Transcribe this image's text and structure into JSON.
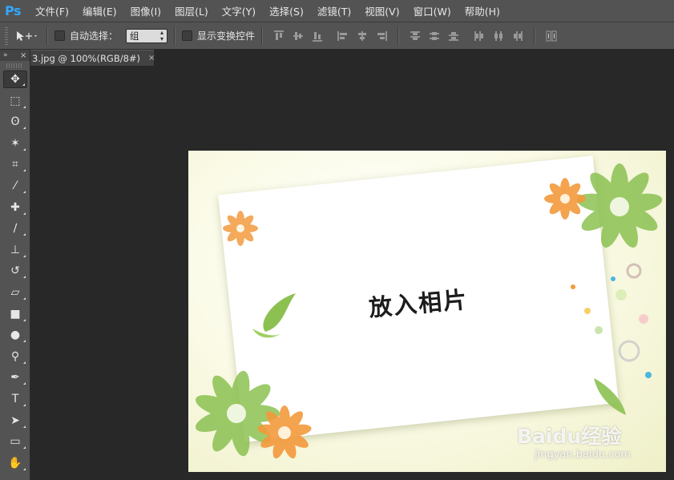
{
  "app": {
    "logo": "Ps"
  },
  "menu": [
    "文件(F)",
    "编辑(E)",
    "图像(I)",
    "图层(L)",
    "文字(Y)",
    "选择(S)",
    "滤镜(T)",
    "视图(V)",
    "窗口(W)",
    "帮助(H)"
  ],
  "options": {
    "auto_select_label": "自动选择：",
    "auto_select_value": "组",
    "show_transform_label": "显示变换控件"
  },
  "panel": {
    "collapse_glyph": "»",
    "close_glyph": "×"
  },
  "document_tab": {
    "title": "3.jpg @ 100%(RGB/8#)",
    "close_glyph": "×"
  },
  "tools": [
    {
      "name": "move-tool-icon",
      "glyph": "✥"
    },
    {
      "name": "marquee-tool-icon",
      "glyph": "⬚"
    },
    {
      "name": "lasso-tool-icon",
      "glyph": "ʘ"
    },
    {
      "name": "magic-wand-tool-icon",
      "glyph": "✶"
    },
    {
      "name": "crop-tool-icon",
      "glyph": "⌗"
    },
    {
      "name": "eyedropper-tool-icon",
      "glyph": "⁄"
    },
    {
      "name": "healing-brush-tool-icon",
      "glyph": "✚"
    },
    {
      "name": "brush-tool-icon",
      "glyph": "∕"
    },
    {
      "name": "clone-stamp-tool-icon",
      "glyph": "⊥"
    },
    {
      "name": "history-brush-tool-icon",
      "glyph": "↺"
    },
    {
      "name": "eraser-tool-icon",
      "glyph": "▱"
    },
    {
      "name": "gradient-tool-icon",
      "glyph": "■"
    },
    {
      "name": "blur-tool-icon",
      "glyph": "●"
    },
    {
      "name": "dodge-tool-icon",
      "glyph": "⚲"
    },
    {
      "name": "pen-tool-icon",
      "glyph": "✒"
    },
    {
      "name": "type-tool-icon",
      "glyph": "T"
    },
    {
      "name": "path-selection-tool-icon",
      "glyph": "➤"
    },
    {
      "name": "rectangle-tool-icon",
      "glyph": "▭"
    },
    {
      "name": "hand-tool-icon",
      "glyph": "✋"
    }
  ],
  "canvas": {
    "card_text": "放入相片",
    "watermark": "Baidu经验",
    "watermark_sub": "jingyan.baidu.com"
  },
  "colors": {
    "accent": "#31a8ff",
    "chrome": "#535353",
    "workspace": "#282828"
  }
}
